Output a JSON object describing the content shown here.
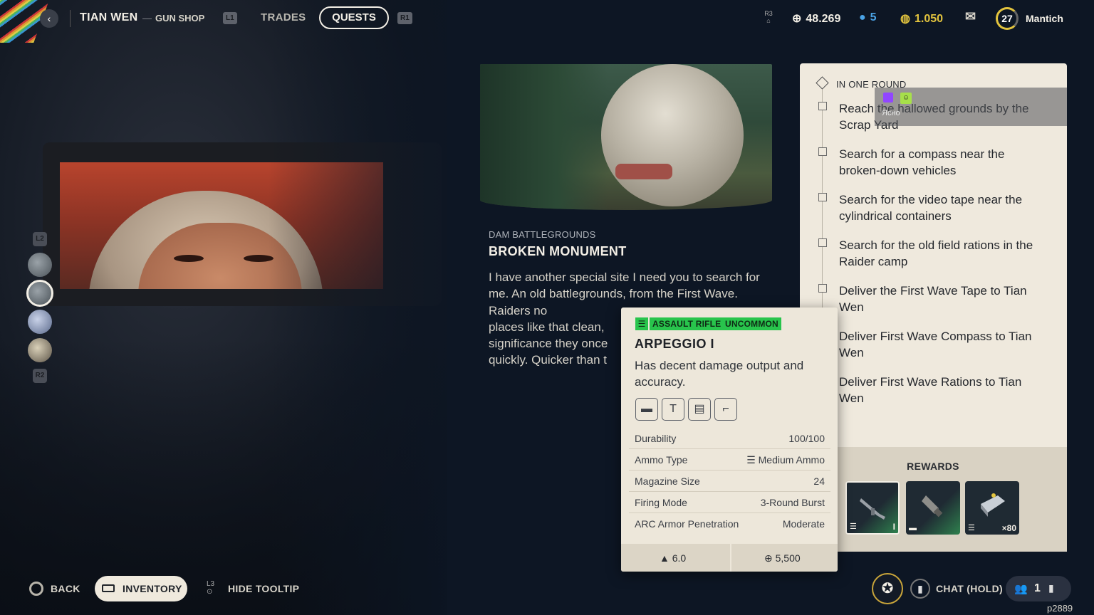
{
  "header": {
    "npc_name": "TIAN WEN",
    "dash": "—",
    "shop_name": "GUN SHOP",
    "hint_left": "L1",
    "hint_right": "R1",
    "tabs": [
      {
        "label": "TRADES",
        "active": false
      },
      {
        "label": "QUESTS",
        "active": true
      }
    ]
  },
  "currencies": {
    "r3_hint": "R3",
    "coins": "48.269",
    "tokens": "5",
    "raider_currency": "1.050",
    "level": "27",
    "username": "Mantich"
  },
  "side_selector": {
    "top_hint": "L2",
    "bottom_hint": "R2",
    "selected_index": 1,
    "count": 4
  },
  "quest": {
    "area": "DAM BATTLEGROUNDS",
    "title": "BROKEN MONUMENT",
    "description": "I have another special site I need you to search for me. An old battlegrounds, from the First Wave. Raiders no",
    "description_line2": "places like that clean,",
    "description_line3": "significance they once",
    "description_line4": "quickly. Quicker than t"
  },
  "objectives": {
    "header": "IN ONE ROUND",
    "items": [
      "Reach the hallowed grounds by the Scrap Yard",
      "Search for a compass near the broken-down vehicles",
      "Search for the video tape near the cylindrical containers",
      "Search for the old field rations in the Raider camp",
      "Deliver the First Wave Tape to Tian Wen",
      "Deliver First Wave Compass to Tian Wen",
      "Deliver First Wave Rations to Tian Wen"
    ]
  },
  "rewards": {
    "label": "REWARDS",
    "items": [
      {
        "name": "assault-rifle",
        "qty": "I",
        "selected": true
      },
      {
        "name": "attachment",
        "qty": "",
        "selected": false
      },
      {
        "name": "ammo",
        "qty": "×80",
        "selected": false
      }
    ]
  },
  "twitch": {
    "text": "Ясно"
  },
  "tooltip": {
    "category": "ASSAULT RIFLE",
    "rarity": "UNCOMMON",
    "rarity_color": "#28c44c",
    "name": "ARPEGGIO I",
    "description": "Has decent damage output and accuracy.",
    "slots": [
      "▬",
      "T",
      "▤",
      "⌐"
    ],
    "stats": [
      {
        "label": "Durability",
        "value": "100/100"
      },
      {
        "label": "Ammo Type",
        "value": "Medium Ammo"
      },
      {
        "label": "Magazine Size",
        "value": "24"
      },
      {
        "label": "Firing Mode",
        "value": "3-Round Burst"
      },
      {
        "label": "ARC Armor Penetration",
        "value": "Moderate"
      }
    ],
    "weight": "6.0",
    "price": "5,500"
  },
  "footer": {
    "back": "BACK",
    "inventory": "INVENTORY",
    "l3_hint": "L3",
    "hide_tooltip": "HIDE TOOLTIP",
    "chat": "CHAT (HOLD)",
    "party_count": "1",
    "build_id": "p2889"
  }
}
